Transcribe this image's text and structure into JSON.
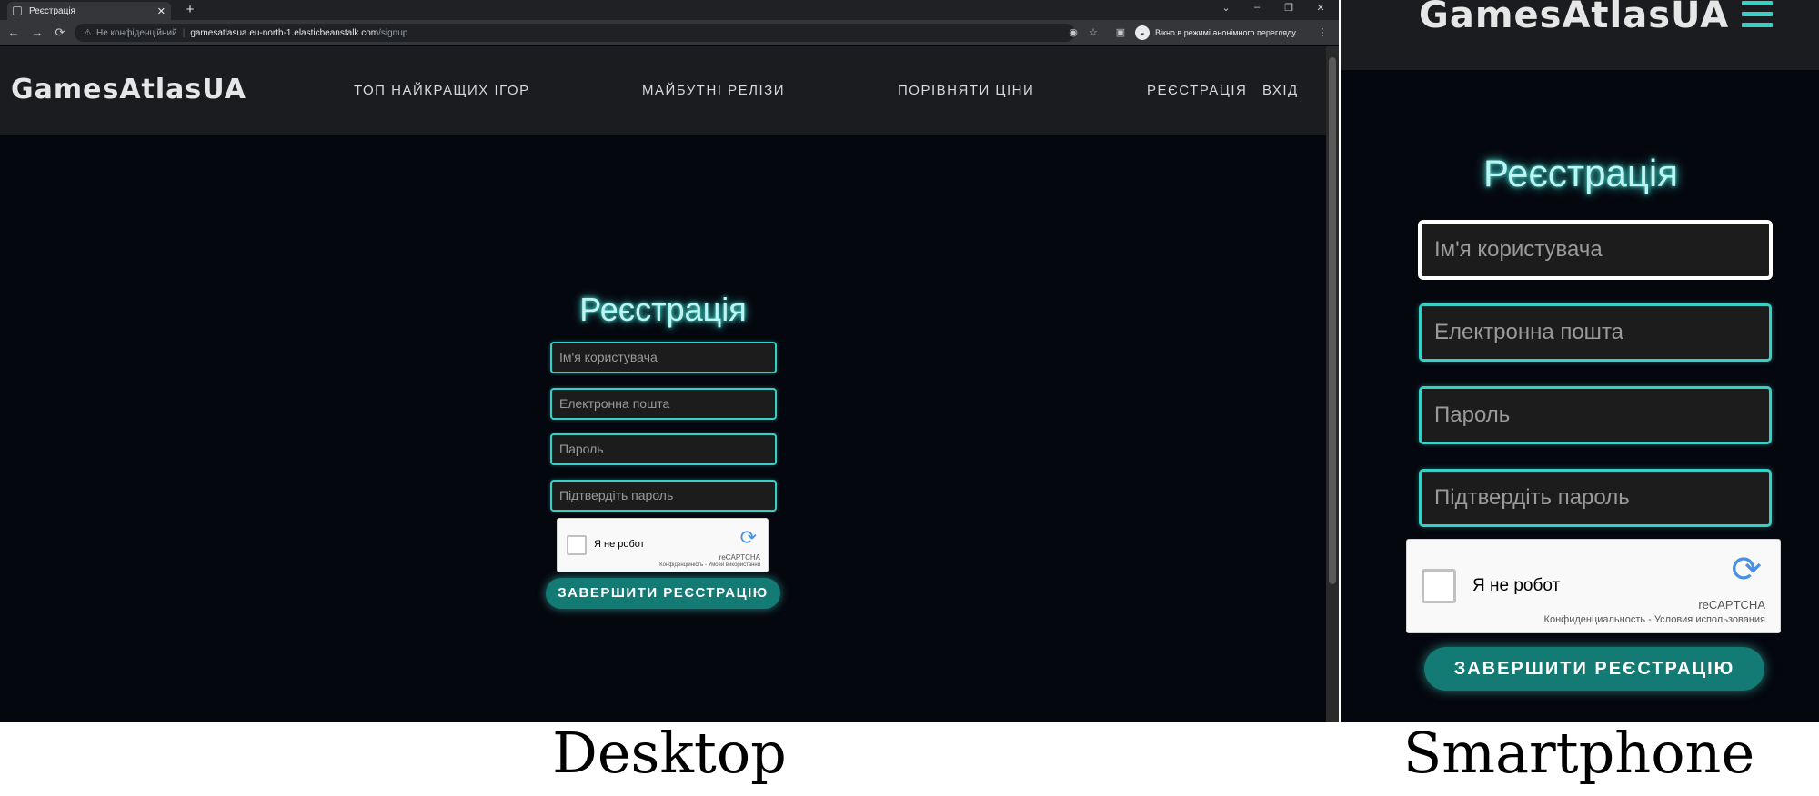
{
  "browser": {
    "tab_title": "Реєстрація",
    "security_label": "Не конфіденційний",
    "url_host": "gamesatlasua.eu-north-1.elasticbeanstalk.com",
    "url_path": "/signup",
    "incognito_label": "Вікно в режимі анонімного перегляду"
  },
  "site": {
    "logo": "GamesAtlasUA",
    "nav": {
      "top_games": "ТОП НАЙКРАЩИХ ІГОР",
      "upcoming": "МАЙБУТНІ РЕЛІЗИ",
      "compare": "ПОРІВНЯТИ ЦІНИ",
      "register": "РЕЄСТРАЦІЯ",
      "login": "ВХІД"
    }
  },
  "form": {
    "heading": "Реєстрація",
    "username_placeholder": "Ім'я користувача",
    "email_placeholder": "Електронна пошта",
    "password_placeholder": "Пароль",
    "confirm_placeholder": "Підтвердіть пароль",
    "submit_label": "ЗАВЕРШИТИ РЕЄСТРАЦІЮ"
  },
  "captcha_desktop": {
    "label": "Я не робот",
    "brand": "reCAPTCHA",
    "terms": "Конфіденційність - Умови використання"
  },
  "captcha_mobile": {
    "label": "Я не робот",
    "brand": "reCAPTCHA",
    "terms": "Конфиденциальность - Условия использования"
  },
  "captions": {
    "desktop": "Desktop",
    "smartphone": "Smartphone"
  },
  "colors": {
    "accent": "#38cfc6",
    "button": "#147a74",
    "page_bg": "#05070e",
    "nav_bg": "#1b1c1f"
  }
}
